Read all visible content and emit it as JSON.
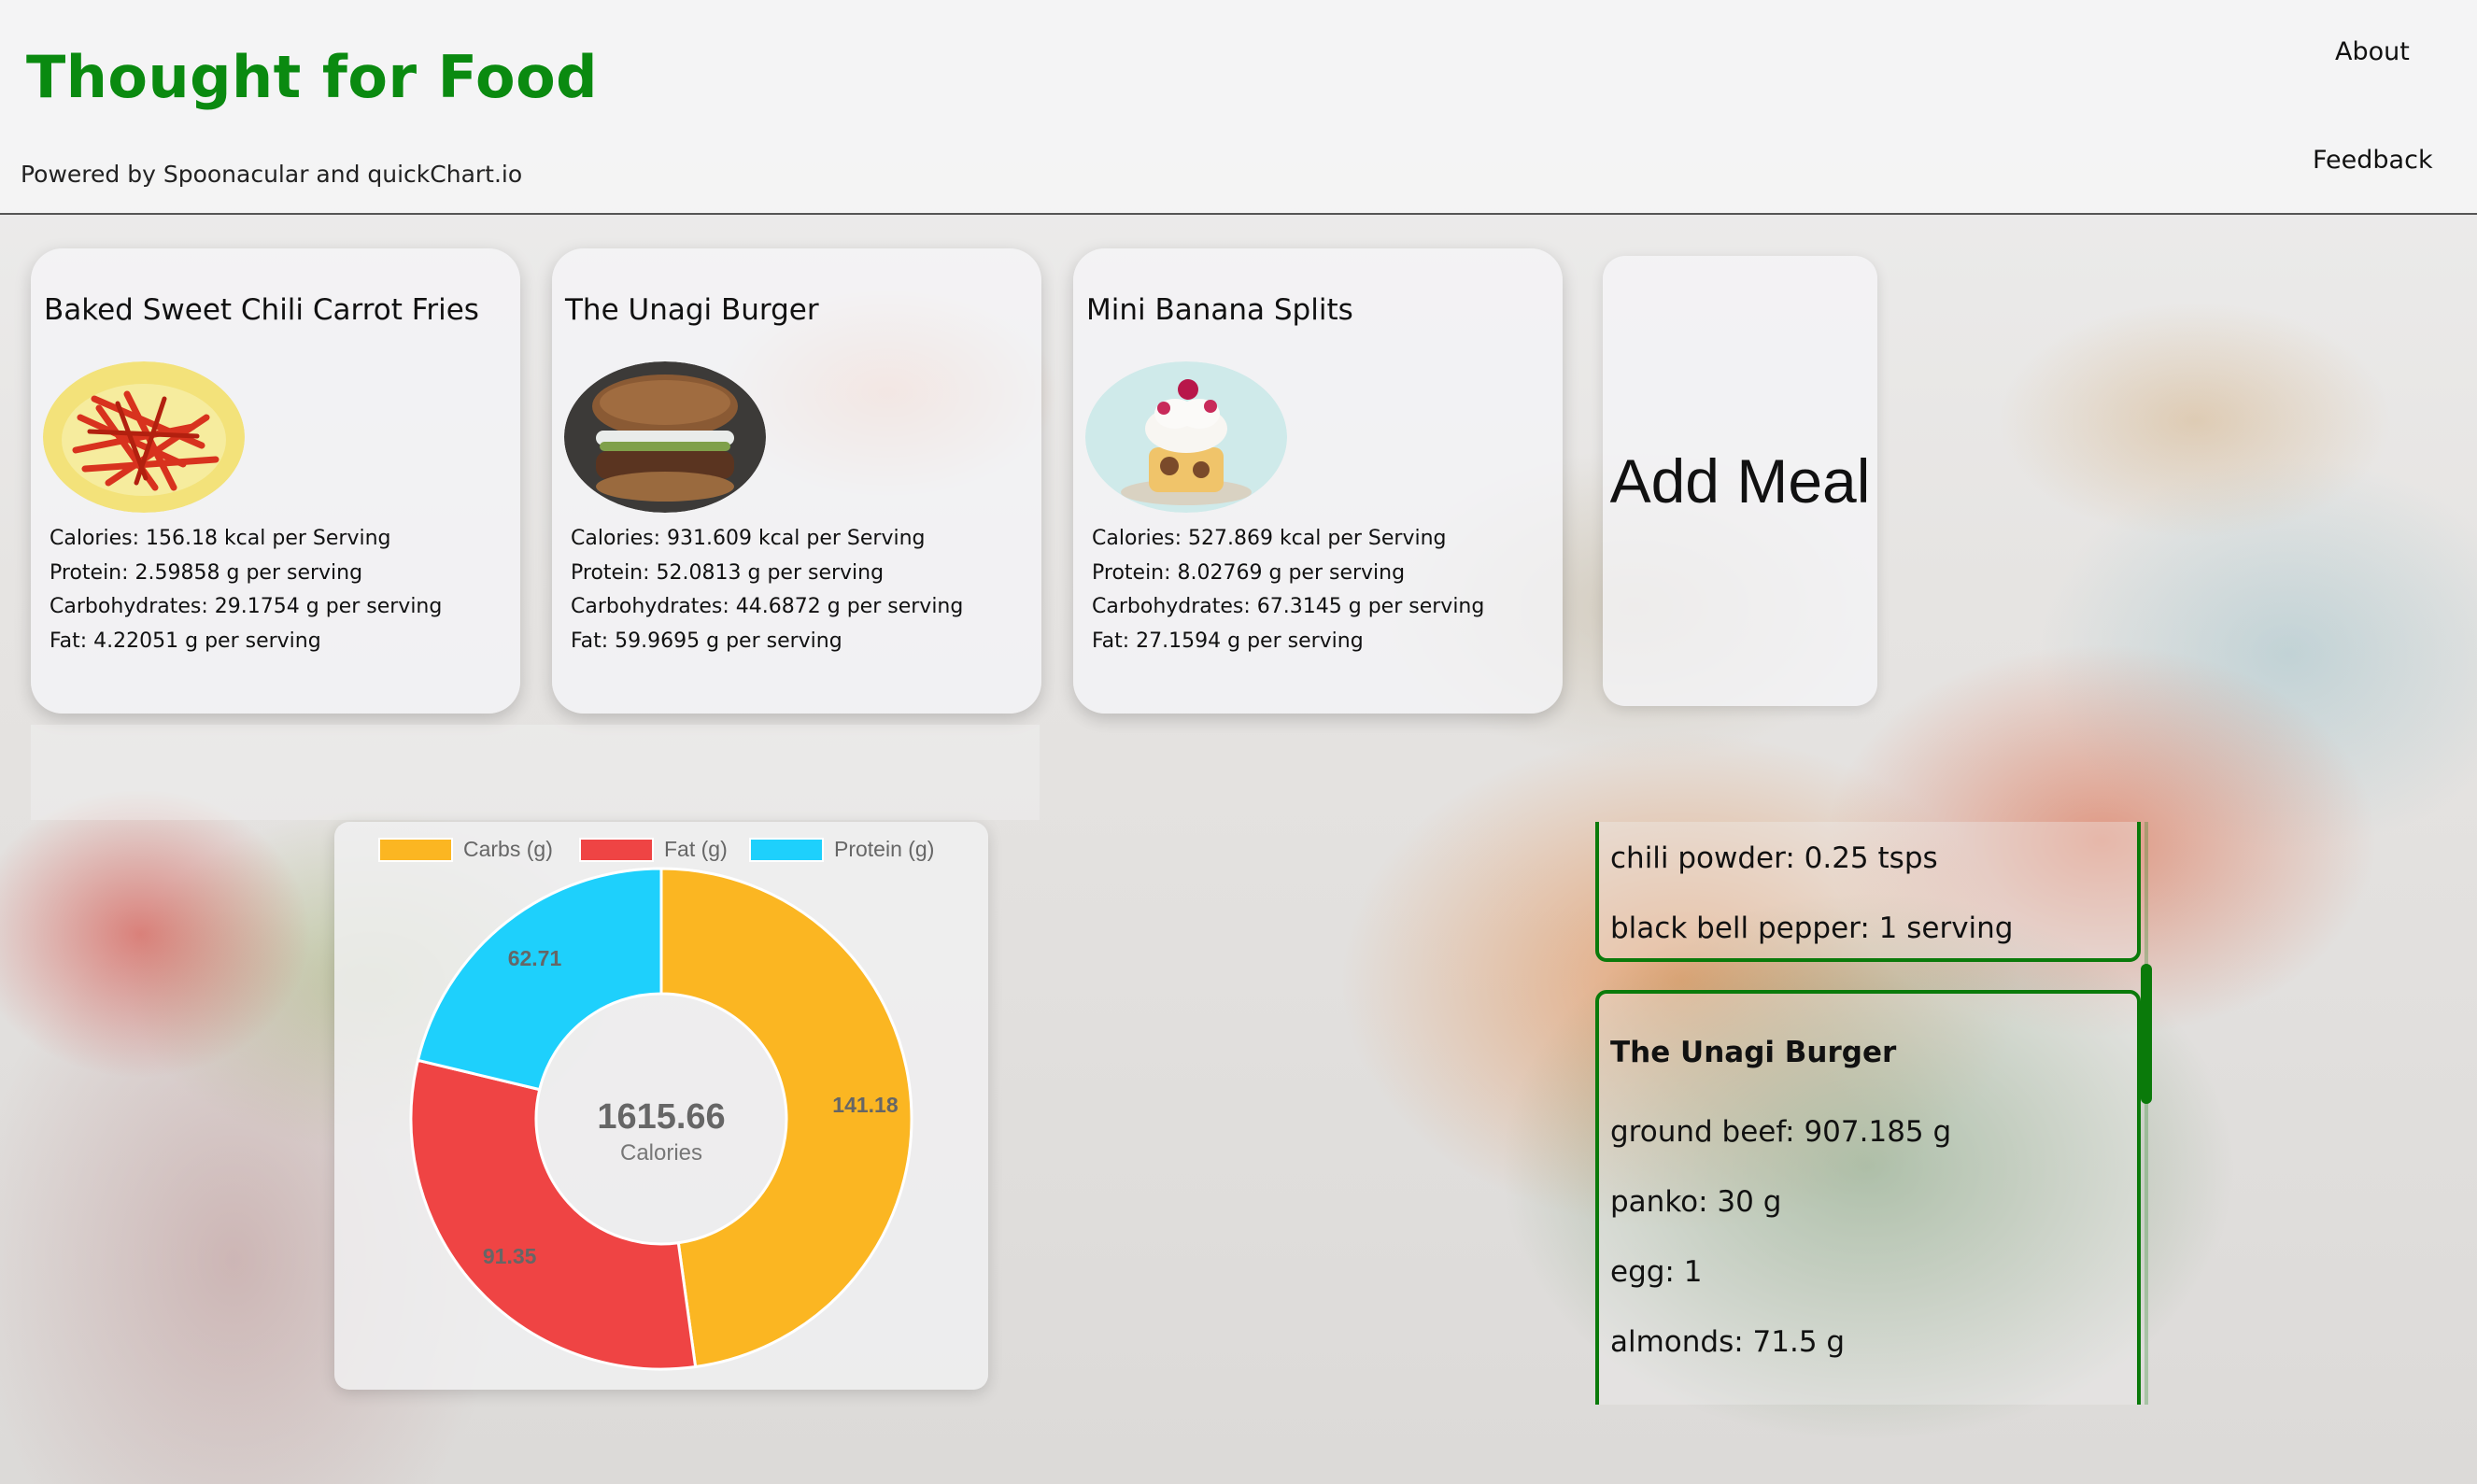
{
  "header": {
    "title": "Thought for Food",
    "powered_by": "Powered by Spoonacular and quickChart.io",
    "nav": {
      "about": "About",
      "feedback": "Feedback"
    }
  },
  "meals": [
    {
      "name": "Baked Sweet Chili Carrot Fries",
      "calories": "Calories: 156.18 kcal per Serving",
      "protein": "Protein: 2.59858 g per serving",
      "carbs": "Carbohydrates: 29.1754 g per serving",
      "fat": "Fat: 4.22051 g per serving"
    },
    {
      "name": "The Unagi Burger",
      "calories": "Calories: 931.609 kcal per Serving",
      "protein": "Protein: 52.0813 g per serving",
      "carbs": "Carbohydrates: 44.6872 g per serving",
      "fat": "Fat: 59.9695 g per serving"
    },
    {
      "name": "Mini Banana Splits",
      "calories": "Calories: 527.869 kcal per Serving",
      "protein": "Protein: 8.02769 g per serving",
      "carbs": "Carbohydrates: 67.3145 g per serving",
      "fat": "Fat: 27.1594 g per serving"
    }
  ],
  "add_meal_label": "Add Meal",
  "chart_data": {
    "type": "pie",
    "categories": [
      "Carbs (g)",
      "Fat (g)",
      "Protein (g)"
    ],
    "values": [
      141.18,
      91.35,
      62.71
    ],
    "colors": [
      "#fbb622",
      "#ef4444",
      "#1ed0fc"
    ],
    "center_value": "1615.66",
    "center_label": "Calories",
    "legend_position": "top"
  },
  "ingredients": {
    "card1_lines": [
      "chili powder: 0.25 tsps",
      "black bell pepper: 1 serving"
    ],
    "card2_title": "The Unagi Burger",
    "card2_lines": [
      "ground beef: 907.185 g",
      "panko: 30 g",
      "egg: 1",
      "almonds: 71.5 g"
    ]
  }
}
